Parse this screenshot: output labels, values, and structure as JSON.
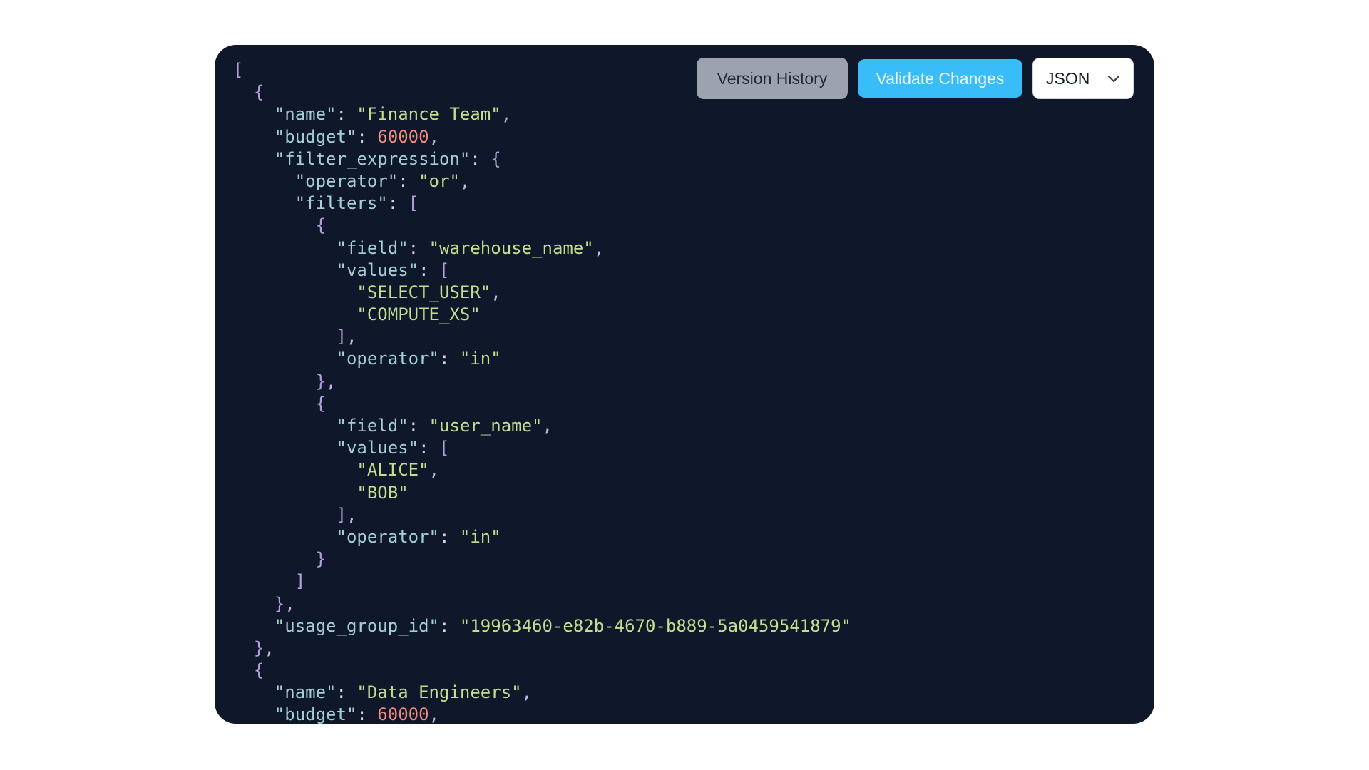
{
  "toolbar": {
    "version_history_label": "Version History",
    "validate_label": "Validate Changes",
    "format_select": {
      "selected": "JSON",
      "icon": "chevron-down-icon"
    }
  },
  "colors": {
    "editor_background": "#0f172a",
    "validate_button": "#38bdf8",
    "version_history_button": "#9ca3af",
    "key": "#a5cfd8",
    "string": "#c3de8e",
    "number": "#f28b7d",
    "bracket": "#b39ddb"
  },
  "editor": {
    "lines": [
      [
        [
          "bracket",
          "["
        ]
      ],
      [
        [
          "ws",
          "  "
        ],
        [
          "bracket",
          "{"
        ]
      ],
      [
        [
          "ws",
          "    "
        ],
        [
          "key",
          "\"name\""
        ],
        [
          "colon",
          ": "
        ],
        [
          "string",
          "\"Finance Team\""
        ],
        [
          "punct",
          ","
        ]
      ],
      [
        [
          "ws",
          "    "
        ],
        [
          "key",
          "\"budget\""
        ],
        [
          "colon",
          ": "
        ],
        [
          "number",
          "60000"
        ],
        [
          "punct",
          ","
        ]
      ],
      [
        [
          "ws",
          "    "
        ],
        [
          "key",
          "\"filter_expression\""
        ],
        [
          "colon",
          ": "
        ],
        [
          "bracket",
          "{"
        ]
      ],
      [
        [
          "ws",
          "      "
        ],
        [
          "key",
          "\"operator\""
        ],
        [
          "colon",
          ": "
        ],
        [
          "string",
          "\"or\""
        ],
        [
          "punct",
          ","
        ]
      ],
      [
        [
          "ws",
          "      "
        ],
        [
          "key",
          "\"filters\""
        ],
        [
          "colon",
          ": "
        ],
        [
          "bracket",
          "["
        ]
      ],
      [
        [
          "ws",
          "        "
        ],
        [
          "bracket",
          "{"
        ]
      ],
      [
        [
          "ws",
          "          "
        ],
        [
          "key",
          "\"field\""
        ],
        [
          "colon",
          ": "
        ],
        [
          "string",
          "\"warehouse_name\""
        ],
        [
          "punct",
          ","
        ]
      ],
      [
        [
          "ws",
          "          "
        ],
        [
          "key",
          "\"values\""
        ],
        [
          "colon",
          ": "
        ],
        [
          "bracket",
          "["
        ]
      ],
      [
        [
          "ws",
          "            "
        ],
        [
          "string",
          "\"SELECT_USER\""
        ],
        [
          "punct",
          ","
        ]
      ],
      [
        [
          "ws",
          "            "
        ],
        [
          "string",
          "\"COMPUTE_XS\""
        ]
      ],
      [
        [
          "ws",
          "          "
        ],
        [
          "bracket",
          "]"
        ],
        [
          "punct",
          ","
        ]
      ],
      [
        [
          "ws",
          "          "
        ],
        [
          "key",
          "\"operator\""
        ],
        [
          "colon",
          ": "
        ],
        [
          "string",
          "\"in\""
        ]
      ],
      [
        [
          "ws",
          "        "
        ],
        [
          "bracket",
          "}"
        ],
        [
          "punct",
          ","
        ]
      ],
      [
        [
          "ws",
          "        "
        ],
        [
          "bracket",
          "{"
        ]
      ],
      [
        [
          "ws",
          "          "
        ],
        [
          "key",
          "\"field\""
        ],
        [
          "colon",
          ": "
        ],
        [
          "string",
          "\"user_name\""
        ],
        [
          "punct",
          ","
        ]
      ],
      [
        [
          "ws",
          "          "
        ],
        [
          "key",
          "\"values\""
        ],
        [
          "colon",
          ": "
        ],
        [
          "bracket",
          "["
        ]
      ],
      [
        [
          "ws",
          "            "
        ],
        [
          "string",
          "\"ALICE\""
        ],
        [
          "punct",
          ","
        ]
      ],
      [
        [
          "ws",
          "            "
        ],
        [
          "string",
          "\"BOB\""
        ]
      ],
      [
        [
          "ws",
          "          "
        ],
        [
          "bracket",
          "]"
        ],
        [
          "punct",
          ","
        ]
      ],
      [
        [
          "ws",
          "          "
        ],
        [
          "key",
          "\"operator\""
        ],
        [
          "colon",
          ": "
        ],
        [
          "string",
          "\"in\""
        ]
      ],
      [
        [
          "ws",
          "        "
        ],
        [
          "bracket",
          "}"
        ]
      ],
      [
        [
          "ws",
          "      "
        ],
        [
          "bracket",
          "]"
        ]
      ],
      [
        [
          "ws",
          "    "
        ],
        [
          "bracket",
          "}"
        ],
        [
          "punct",
          ","
        ]
      ],
      [
        [
          "ws",
          "    "
        ],
        [
          "key",
          "\"usage_group_id\""
        ],
        [
          "colon",
          ": "
        ],
        [
          "string",
          "\"19963460-e82b-4670-b889-5a0459541879\""
        ]
      ],
      [
        [
          "ws",
          "  "
        ],
        [
          "bracket",
          "}"
        ],
        [
          "punct",
          ","
        ]
      ],
      [
        [
          "ws",
          "  "
        ],
        [
          "bracket",
          "{"
        ]
      ],
      [
        [
          "ws",
          "    "
        ],
        [
          "key",
          "\"name\""
        ],
        [
          "colon",
          ": "
        ],
        [
          "string",
          "\"Data Engineers\""
        ],
        [
          "punct",
          ","
        ]
      ],
      [
        [
          "ws",
          "    "
        ],
        [
          "key",
          "\"budget\""
        ],
        [
          "colon",
          ": "
        ],
        [
          "number",
          "60000"
        ],
        [
          "punct",
          ","
        ]
      ]
    ]
  }
}
